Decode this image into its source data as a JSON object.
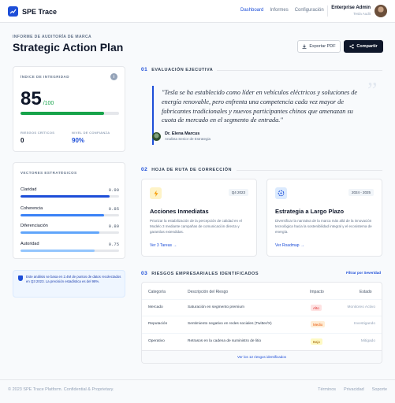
{
  "header": {
    "app_name": "SPE Trace",
    "nav": [
      "Dashboard",
      "Informes",
      "Configuración"
    ],
    "user_name": "Enterprise Admin",
    "user_role": "Tesla Audit"
  },
  "page": {
    "eyebrow": "INFORME DE AUDITORÍA DE MARCA",
    "title": "Strategic Action Plan",
    "export_label": "Exportar PDF",
    "share_label": "Compartir"
  },
  "integrity": {
    "label": "ÍNDICE DE INTEGRIDAD",
    "info": "i",
    "score": "85",
    "score_denominator": "/100",
    "score_fraction": 0.85,
    "critical_label": "RIESGOS CRÍTICOS",
    "critical_value": "0",
    "confidence_label": "NIVEL DE CONFIANZA",
    "confidence_value": "90%",
    "bar_color": "#16a34a"
  },
  "vectors": {
    "label": "VECTORES ESTRATÉGICOS",
    "items": [
      {
        "name": "Claridad",
        "value": "0.90",
        "fraction": 0.9,
        "color": "#1d4ed8"
      },
      {
        "name": "Coherencia",
        "value": "0.85",
        "fraction": 0.85,
        "color": "#3b82f6"
      },
      {
        "name": "Diferenciación",
        "value": "0.80",
        "fraction": 0.8,
        "color": "#60a5fa"
      },
      {
        "name": "Autoridad",
        "value": "0.75",
        "fraction": 0.75,
        "color": "#93c5fd"
      }
    ]
  },
  "note": {
    "text": "Este análisis se basa en 2.4M de puntos de datos recolectados en Q3 2023. La precisión estadística es del 98%."
  },
  "executive": {
    "number": "01",
    "title": "EVALUACIÓN EJECUTIVA",
    "quote": "\"Tesla se ha establecido como líder en vehículos eléctricos y soluciones de energía renovable, pero enfrenta una competencia cada vez mayor de fabricantes tradicionales y nuevos participantes chinos que amenazan su cuota de mercado en el segmento de entrada.\"",
    "author_name": "Dr. Elena Marcus",
    "author_role": "Analista Senior de Estrategia"
  },
  "roadmap": {
    "number": "02",
    "title": "HOJA DE RUTA DE CORRECCIÓN",
    "cards": [
      {
        "icon": "lightning-icon",
        "badge": "Q4 2023",
        "title": "Acciones Inmediatas",
        "desc": "Priorizar la estabilización de la percepción de calidad en el Modelo 3 mediante campañas de comunicación directa y garantías extendidas.",
        "link": "Ver 3 Tareas →",
        "accent": "#f59e0b",
        "icon_bg": "#fef3c7"
      },
      {
        "icon": "target-icon",
        "badge": "2024 - 2025",
        "title": "Estrategia a Largo Plazo",
        "desc": "Diversificar la narrativa de la marca más allá de la innovación tecnológica hacia la sostenibilidad integral y el ecosistema de energía.",
        "link": "Ver Roadmap →",
        "accent": "#1d4ed8",
        "icon_bg": "#dbeafe"
      }
    ]
  },
  "risks": {
    "number": "03",
    "title": "RIESGOS EMPRESARIALES IDENTIFICADOS",
    "filter_label": "Filtrar por Severidad",
    "columns": [
      "Categoría",
      "Descripción del Riesgo",
      "Impacto",
      "Estado"
    ],
    "rows": [
      {
        "category": "Mercado",
        "description": "Saturación en segmento premium",
        "impact": "Alto",
        "impact_bg": "#fee2e2",
        "impact_fg": "#dc2626",
        "status": "Monitoreo Activo"
      },
      {
        "category": "Reputación",
        "description": "Sentimiento negativo en redes sociales (Twitter/X)",
        "impact": "Medio",
        "impact_bg": "#ffedd5",
        "impact_fg": "#ea580c",
        "status": "Investigando"
      },
      {
        "category": "Operativo",
        "description": "Retrasos en la cadena de suministro de litio",
        "impact": "Bajo",
        "impact_bg": "#fef9c3",
        "impact_fg": "#a16207",
        "status": "Mitigado"
      }
    ],
    "footer_link": "Ver los 12 riesgos identificados"
  },
  "footer": {
    "copyright": "© 2023 SPE Trace Platform. Confidential & Proprietary.",
    "links": [
      "Términos",
      "Privacidad",
      "Soporte"
    ]
  }
}
